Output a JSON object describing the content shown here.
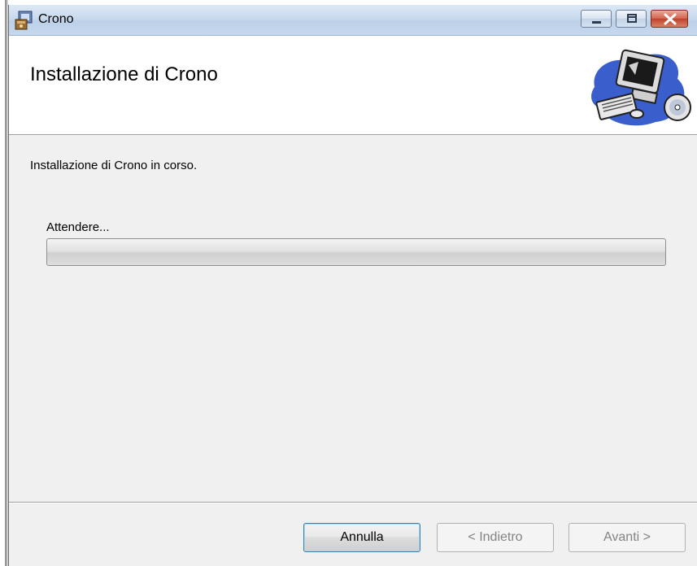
{
  "window": {
    "title": "Crono",
    "caption_buttons": [
      "minimize-icon",
      "maximize-icon",
      "close-icon"
    ]
  },
  "header": {
    "title": "Installazione di Crono",
    "image": "computer-install-icon"
  },
  "body": {
    "status": "Installazione di Crono in corso.",
    "wait_label": "Attendere...",
    "progress": 0
  },
  "footer": {
    "cancel_label": "Annulla",
    "back_label": "< Indietro",
    "next_label": "Avanti >"
  },
  "colors": {
    "titlebar": "#c9daee",
    "header_bg": "#ffffff",
    "window_bg": "#f0f0f0",
    "close_button": "#c0412b",
    "default_button_border": "#3c7fb1"
  }
}
